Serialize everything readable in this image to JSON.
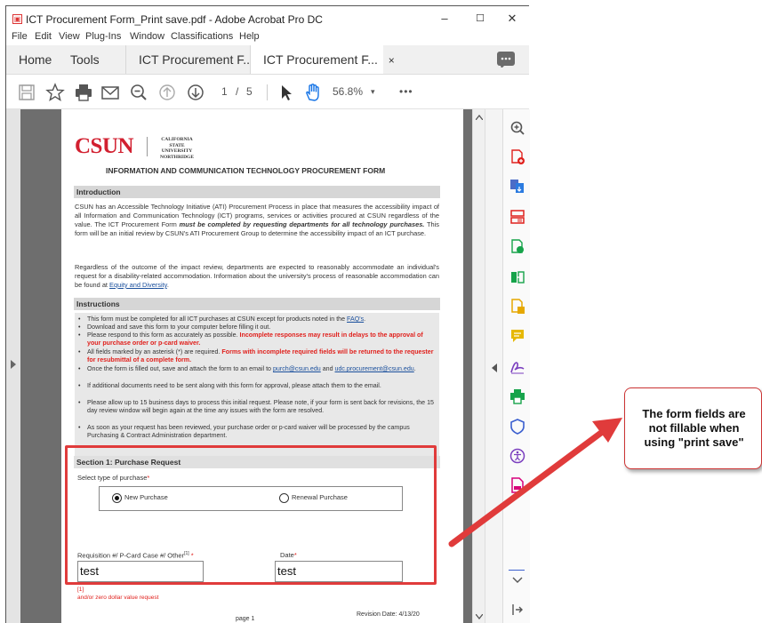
{
  "window": {
    "title": "ICT Procurement Form_Print save.pdf - Adobe Acrobat Pro DC",
    "minimize": "–",
    "maximize": "☐",
    "close": "✕"
  },
  "menu": [
    "File",
    "Edit",
    "View",
    "Plug-Ins",
    "Window",
    "Classifications",
    "Help"
  ],
  "tabs": {
    "home": "Home",
    "tools": "Tools",
    "doc1": "ICT Procurement F...",
    "doc2": "ICT Procurement F...",
    "doc2_close": "×"
  },
  "toolbar": {
    "page_current": "1",
    "page_sep": "/",
    "page_total": "5",
    "zoom": "56.8%",
    "more": "•••"
  },
  "document": {
    "logo": "CSUN",
    "logo_sub": [
      "CALIFORNIA",
      "STATE UNIVERSITY",
      "NORTHRIDGE"
    ],
    "heading": "INFORMATION AND COMMUNICATION TECHNOLOGY PROCUREMENT FORM",
    "intro_title": "Introduction",
    "intro_p1_a": "CSUN has an Accessible Technology Initiative (ATI) Procurement Process in place that measures the accessibility impact of all Information and Communication Technology (ICT) programs, services or activities procured at CSUN regardless of the value. The ICT Procurement Form ",
    "intro_p1_b": "must be completed by requesting departments for all technology purchases.",
    "intro_p1_c": " This form will be an initial review by CSUN's ATI Procurement Group to determine the accessibility impact of an ICT purchase.",
    "intro_p2_a": "Regardless of the outcome of the impact review, departments are expected to reasonably accommodate an individual's request for a disability-related accommodation. Information about the university's process of reasonable accommodation can be found at ",
    "intro_p2_link": "Equity and Diversity",
    "intro_p2_end": ".",
    "instr_title": "Instructions",
    "b1_a": "This form must be completed for all ICT purchases at CSUN except for products noted in the ",
    "b1_link": "FAQ's",
    "b1_end": ".",
    "b2": "Download and save this form to your computer before filling it out.",
    "b3_a": "Please respond to this form as accurately as possible. ",
    "b3_red": "Incomplete responses may result in delays to the approval of your purchase order or p-card waiver.",
    "b4_a": "All fields marked by an asterisk (*) are required. ",
    "b4_red": "Forms with incomplete required fields will be returned to the requester for resubmittal of a complete form.",
    "b5_a": "Once the form is filled out, save and attach the form to an email to ",
    "b5_link1": "purch@csun.edu",
    "b5_and": " and ",
    "b5_link2": "udc.procurement@csun.edu",
    "b5_end": ".",
    "b6": "If additional documents need to be sent along with this form for approval, please attach them to the email.",
    "b7": "Please allow up to 15 business days to process this initial request. Please note, if your form is sent back for revisions, the 15 day review window will begin again at the time any issues with the form are resolved.",
    "b8": "As soon as your request has been reviewed, your purchase order or p-card waiver will be processed by the campus Purchasing & Contract Administration department.",
    "s1_title": "Section 1: Purchase Request",
    "purchase_type_label": "Select type of purchase",
    "asterisk": "*",
    "opt_new": "New Purchase",
    "opt_renewal": "Renewal Purchase",
    "req_label": "Requisition #/ P-Card Case #/ Other",
    "req_sup": "[1]",
    "req_value": "test",
    "date_label": "Date",
    "date_value": "test",
    "footnote_sup": "[1]",
    "footnote_tail": "and/or zero dollar value request",
    "page_footer": "page 1",
    "revision": "Revision Date: 4/13/20"
  },
  "callout": {
    "text_line1": "The form fields are",
    "text_line2": "not fillable when",
    "text_line3": "using \"print save\""
  },
  "colors": {
    "annotation_red": "#e03b3b",
    "csun_red": "#d22030"
  },
  "right_tools": [
    "zoom-icon",
    "export-pdf-icon",
    "create-pdf-icon",
    "organize-pages-icon",
    "edit-pdf-icon",
    "combine-files-icon",
    "export-icon",
    "comment-icon",
    "fill-sign-icon",
    "print-production-icon",
    "protect-icon",
    "accessibility-icon",
    "pdf-standards-icon"
  ]
}
